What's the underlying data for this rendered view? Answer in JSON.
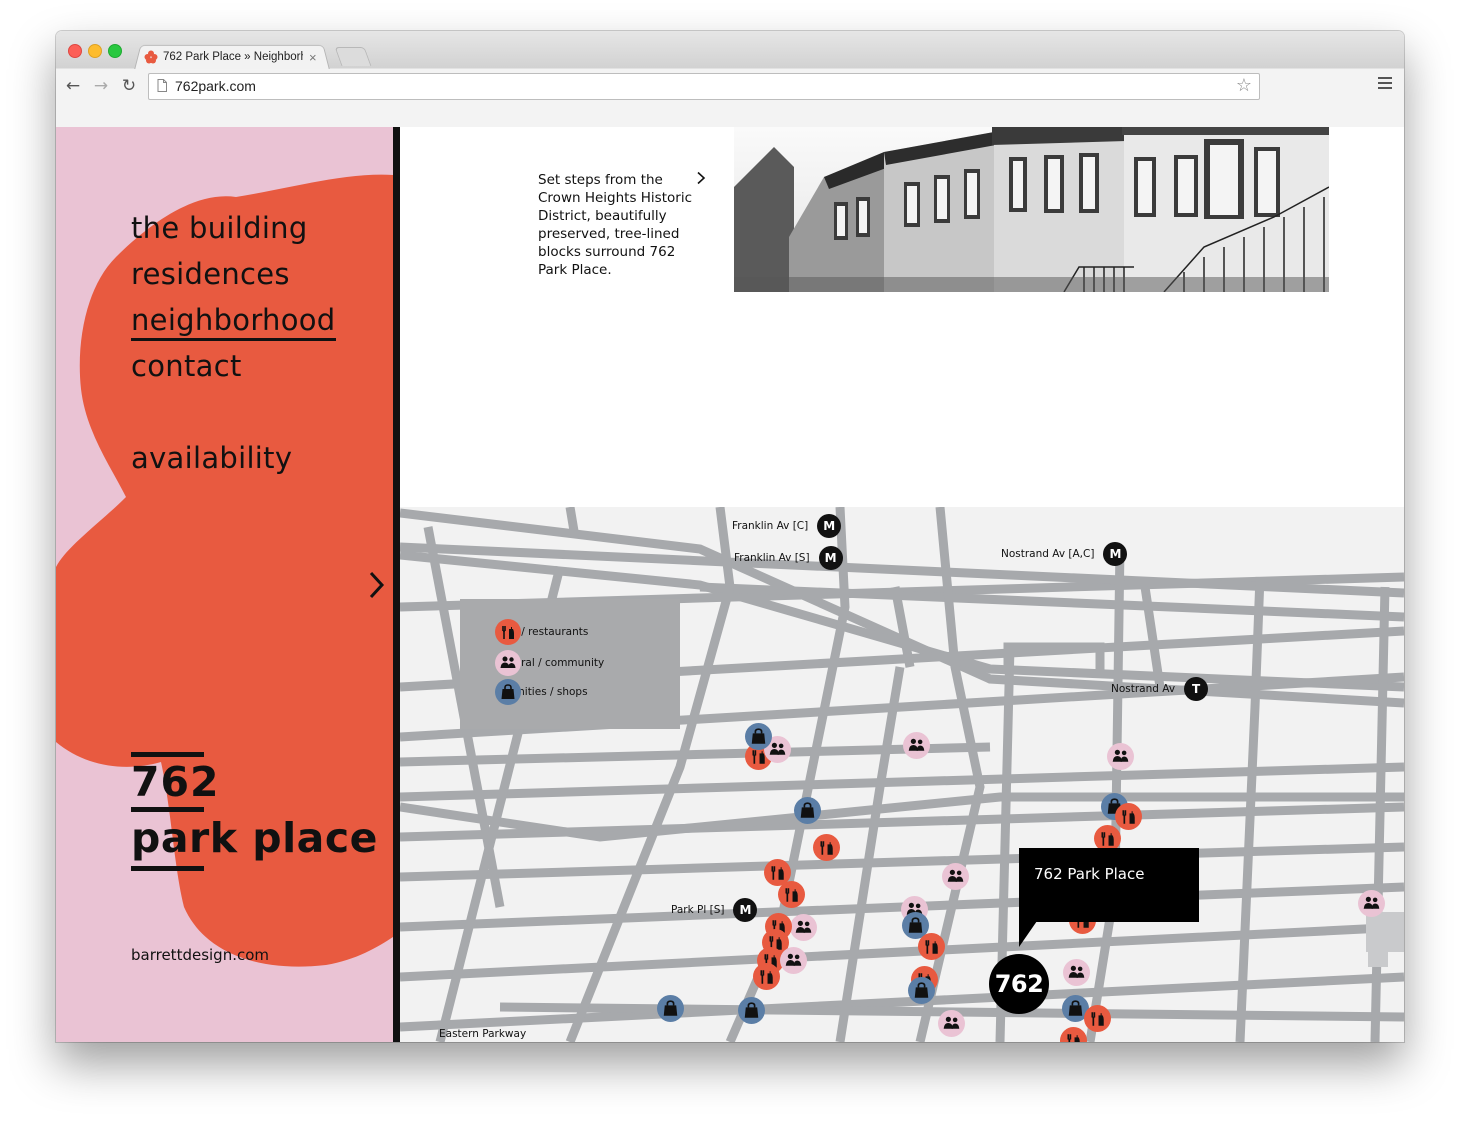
{
  "browser": {
    "tab_title": "762 Park Place » Neighborhood",
    "tab_close": "×",
    "url": "762park.com",
    "back_glyph": "←",
    "forward_glyph": "→",
    "reload_glyph": "↻",
    "star_glyph": "☆"
  },
  "sidebar": {
    "nav": [
      {
        "label": "the building"
      },
      {
        "label": "residences"
      },
      {
        "label": "neighborhood"
      },
      {
        "label": "contact"
      }
    ],
    "availability": "availability",
    "logo_number": "762",
    "logo_name": "park place",
    "credit": "barrettdesign.com",
    "colors": {
      "background": "#eac3d4",
      "blob": "#e85a40"
    }
  },
  "intro": {
    "text": "Set steps from the Crown Heights Historic District, beautifully preserved, tree-lined blocks surround 762 Park Place."
  },
  "map": {
    "legend": [
      {
        "label": "bars / restaurants",
        "icon": "bar-icon",
        "color": "#e85a40"
      },
      {
        "label": "cultural / community",
        "icon": "people-icon",
        "color": "#eac3d4"
      },
      {
        "label": "amenities / shops",
        "icon": "bag-icon",
        "color": "#5b7ea6"
      }
    ],
    "stations": [
      {
        "label": "Franklin Av [C]",
        "line": "M"
      },
      {
        "label": "Franklin Av [S]",
        "line": "M"
      },
      {
        "label": "Nostrand Av [A,C]",
        "line": "M"
      },
      {
        "label": "Nostrand Av",
        "line": "T"
      },
      {
        "label": "Park Pl [S]",
        "line": "M"
      }
    ],
    "street_label": "Eastern Parkway",
    "callout": "762 Park Place",
    "marker": "762"
  }
}
